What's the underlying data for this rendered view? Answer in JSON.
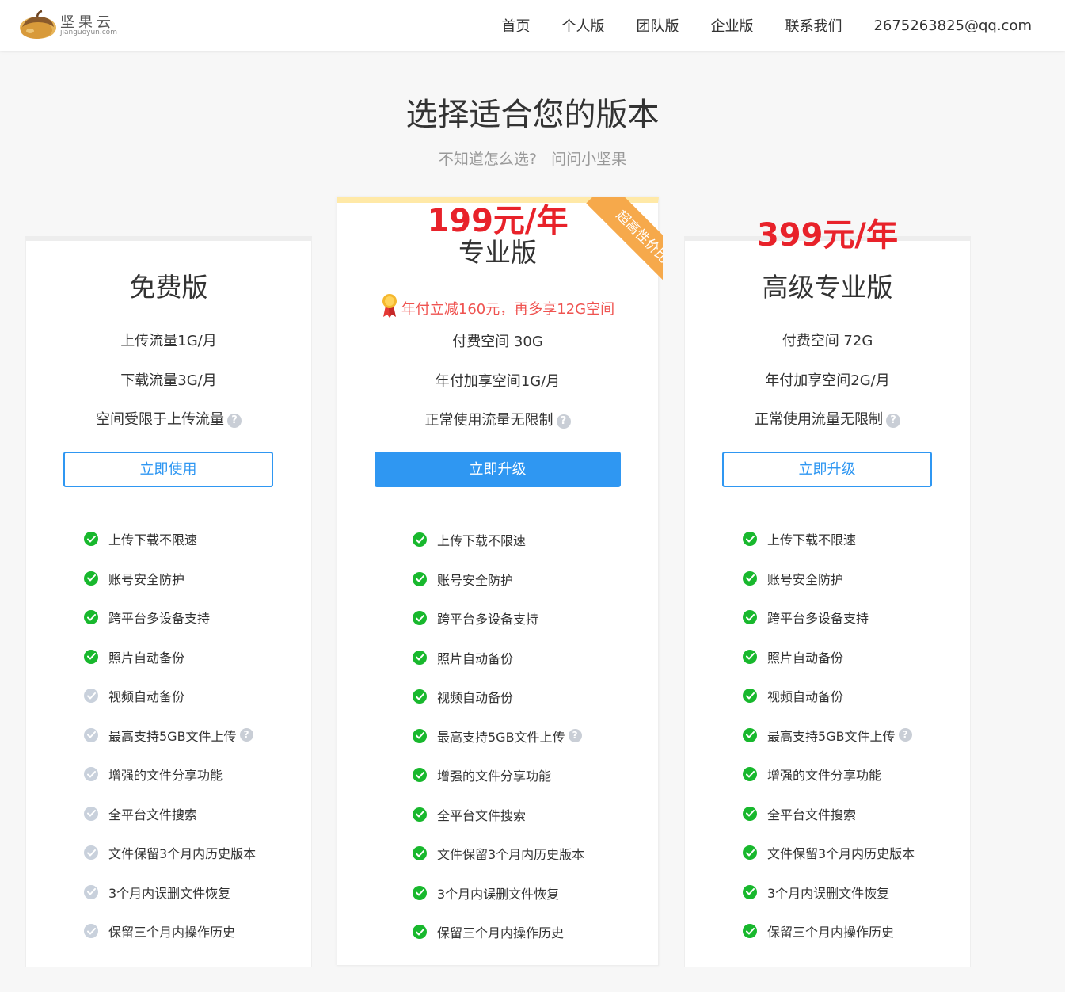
{
  "header": {
    "logo_text": "坚果云",
    "logo_sub": "jianguoyun.com",
    "nav": [
      "首页",
      "个人版",
      "团队版",
      "企业版",
      "联系我们",
      "2675263825@qq.com"
    ]
  },
  "hero": {
    "title": "选择适合您的版本",
    "subtitle_1": "不知道怎么选?",
    "subtitle_2": "问问小坚果"
  },
  "plans": [
    {
      "name": "免费版",
      "price": "",
      "specs": [
        "上传流量1G/月",
        "下载流量3G/月",
        "空间受限于上传流量"
      ],
      "button": "立即使用",
      "features": [
        {
          "label": "上传下载不限速",
          "on": true
        },
        {
          "label": "账号安全防护",
          "on": true
        },
        {
          "label": "跨平台多设备支持",
          "on": true
        },
        {
          "label": "照片自动备份",
          "on": true
        },
        {
          "label": "视频自动备份",
          "on": false
        },
        {
          "label": "最高支持5GB文件上传",
          "on": false,
          "help": true
        },
        {
          "label": "增强的文件分享功能",
          "on": false
        },
        {
          "label": "全平台文件搜索",
          "on": false
        },
        {
          "label": "文件保留3个月内历史版本",
          "on": false
        },
        {
          "label": "3个月内误删文件恢复",
          "on": false
        },
        {
          "label": "保留三个月内操作历史",
          "on": false
        }
      ]
    },
    {
      "name": "专业版",
      "price": "199元/年",
      "ribbon": "超高性价比",
      "promo": "年付立减160元，再多享12G空间",
      "specs": [
        "付费空间 30G",
        "年付加享空间1G/月",
        "正常使用流量无限制"
      ],
      "button": "立即升级",
      "features": [
        {
          "label": "上传下载不限速",
          "on": true
        },
        {
          "label": "账号安全防护",
          "on": true
        },
        {
          "label": "跨平台多设备支持",
          "on": true
        },
        {
          "label": "照片自动备份",
          "on": true
        },
        {
          "label": "视频自动备份",
          "on": true
        },
        {
          "label": "最高支持5GB文件上传",
          "on": true,
          "help": true
        },
        {
          "label": "增强的文件分享功能",
          "on": true
        },
        {
          "label": "全平台文件搜索",
          "on": true
        },
        {
          "label": "文件保留3个月内历史版本",
          "on": true
        },
        {
          "label": "3个月内误删文件恢复",
          "on": true
        },
        {
          "label": "保留三个月内操作历史",
          "on": true
        }
      ]
    },
    {
      "name": "高级专业版",
      "price": "399元/年",
      "specs": [
        "付费空间 72G",
        "年付加享空间2G/月",
        "正常使用流量无限制"
      ],
      "button": "立即升级",
      "features": [
        {
          "label": "上传下载不限速",
          "on": true
        },
        {
          "label": "账号安全防护",
          "on": true
        },
        {
          "label": "跨平台多设备支持",
          "on": true
        },
        {
          "label": "照片自动备份",
          "on": true
        },
        {
          "label": "视频自动备份",
          "on": true
        },
        {
          "label": "最高支持5GB文件上传",
          "on": true,
          "help": true
        },
        {
          "label": "增强的文件分享功能",
          "on": true
        },
        {
          "label": "全平台文件搜索",
          "on": true
        },
        {
          "label": "文件保留3个月内历史版本",
          "on": true
        },
        {
          "label": "3个月内误删文件恢复",
          "on": true
        },
        {
          "label": "保留三个月内操作历史",
          "on": true
        }
      ]
    }
  ],
  "colors": {
    "accent": "#2f97f2",
    "price": "#e8222a",
    "check_on": "#18b82d",
    "check_off": "#c9d1dc",
    "ribbon": "#f6a94b"
  }
}
